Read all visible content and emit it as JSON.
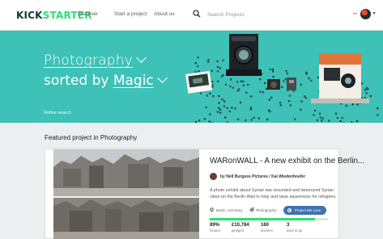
{
  "header": {
    "logo_part1": "KICK",
    "logo_part2": "STARTER",
    "nav": [
      "Discover",
      "Start a project",
      "About us"
    ],
    "search_placeholder": "Search Projects",
    "more": "••"
  },
  "hero": {
    "category": "Photography",
    "sorted_by": "sorted by",
    "sort": "Magic",
    "refine": "Refine search"
  },
  "featured": {
    "heading": "Featured project in Photography",
    "title": "WARonWALL - A new exhibit on the Berlin...",
    "creator": "by Nell Burgess Pictures / Kai Wiedenhoefer",
    "blurb": "A photo exhibit about Syrian war wounded and destroyed Syrian cities on the Berlin Wall to help and raise awareness for refugees.",
    "location": "Berlin, Germany",
    "category": "Photography",
    "badge": "Project We Love",
    "progress": 0.89,
    "stats": [
      {
        "value": "89%",
        "label": "funded"
      },
      {
        "value": "£10,784",
        "label": "pledged"
      },
      {
        "value": "160",
        "label": "backers"
      },
      {
        "value": "3",
        "label": "days to go"
      }
    ]
  },
  "colors": {
    "brand_green": "#2bde73",
    "hero_teal": "#3ec1b6",
    "badge_blue": "#3f72ae"
  },
  "icons": [
    "search-icon",
    "avatar",
    "chevron-down-icon",
    "location-pin-icon",
    "camera-tag-icon",
    "kickstarter-k-icon"
  ]
}
